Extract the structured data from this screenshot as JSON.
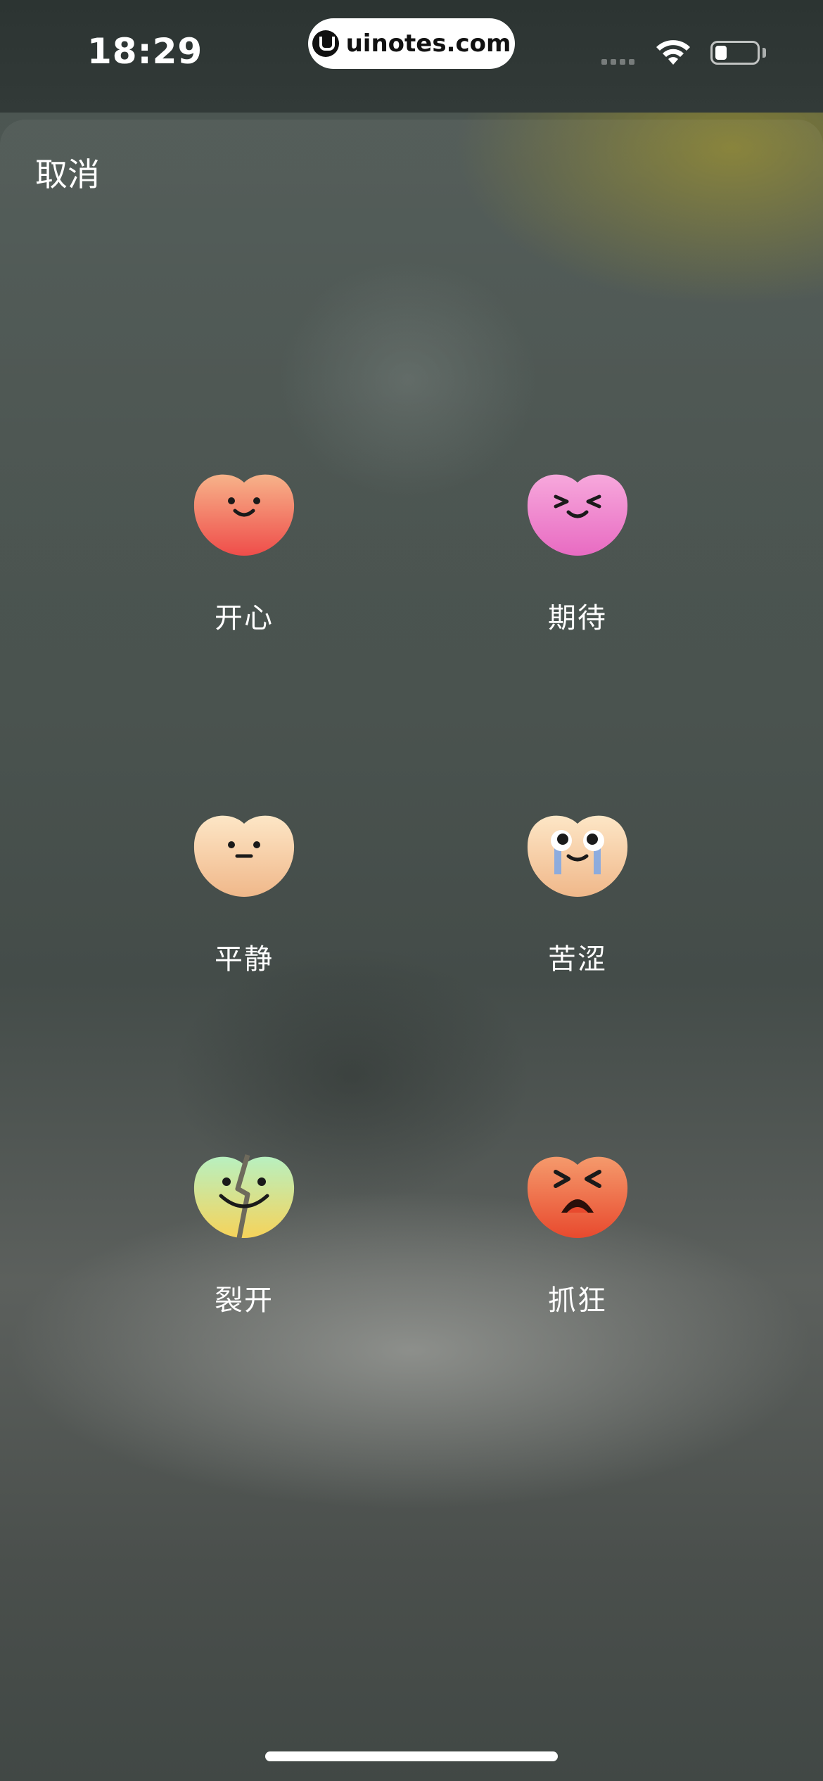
{
  "status_bar": {
    "time": "18:29",
    "url_badge": "uinotes.com"
  },
  "header": {
    "cancel_label": "取消"
  },
  "moods": [
    {
      "label": "开心",
      "icon": "happy-heart-icon",
      "colors": [
        "#f7b38a",
        "#ef4d4a"
      ]
    },
    {
      "label": "期待",
      "icon": "expecting-heart-icon",
      "colors": [
        "#f7a8dc",
        "#e86bc2"
      ]
    },
    {
      "label": "平静",
      "icon": "calm-heart-icon",
      "colors": [
        "#fde6c6",
        "#f0b88a"
      ]
    },
    {
      "label": "苦涩",
      "icon": "bitter-crying-heart-icon",
      "colors": [
        "#fde6c6",
        "#f0b88a"
      ]
    },
    {
      "label": "裂开",
      "icon": "cracked-heart-icon",
      "colors": [
        "#b8f0c0",
        "#f6d35a"
      ]
    },
    {
      "label": "抓狂",
      "icon": "furious-heart-icon",
      "colors": [
        "#f59a6c",
        "#e84a2e"
      ]
    }
  ]
}
